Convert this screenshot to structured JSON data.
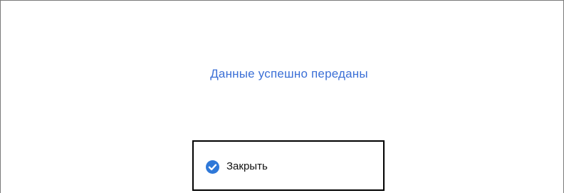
{
  "dialog": {
    "message": "Данные успешно переданы",
    "close_button_label": "Закрыть",
    "close_icon": "checkmark-circle-icon"
  },
  "colors": {
    "message_text": "#3b6fd6",
    "icon_fill": "#2f78d8",
    "button_border": "#000000",
    "window_edge": "#7a7a7a"
  }
}
